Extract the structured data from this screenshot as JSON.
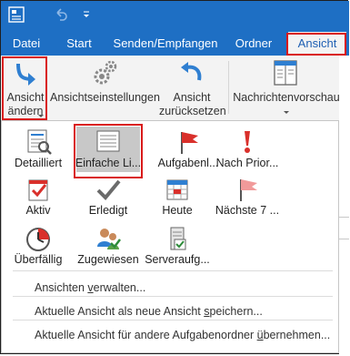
{
  "tabs": [
    "Datei",
    "Start",
    "Senden/Empfangen",
    "Ordner",
    "Ansicht"
  ],
  "ribbon": {
    "change_view": [
      "Ansicht",
      "ändern"
    ],
    "view_settings": "Ansichtseinstellungen",
    "reset_view": [
      "Ansicht",
      "zurücksetzen"
    ],
    "reading_pane": "Nachrichtenvorschau"
  },
  "gallery": {
    "row1": [
      "Detailliert",
      "Einfache Li...",
      "Aufgabenl...",
      "Nach Prior..."
    ],
    "row2": [
      "Aktiv",
      "Erledigt",
      "Heute",
      "Nächste 7 ..."
    ],
    "row3": [
      "Überfällig",
      "Zugewiesen",
      "Serveraufg..."
    ]
  },
  "menu": {
    "manage": {
      "pre": "Ansichten ",
      "u": "v",
      "post": "erwalten..."
    },
    "save_as": {
      "pre": "Aktuelle Ansicht als neue Ansicht ",
      "u": "s",
      "post": "peichern..."
    },
    "apply": {
      "pre": "Aktuelle Ansicht für andere Aufgabenordner ",
      "u": "ü",
      "post": "bernehmen..."
    }
  },
  "colors": {
    "ribbon_blue": "#1e6fc4",
    "highlight_red": "#d91a1a",
    "selected_gray": "#c8c8c8"
  }
}
